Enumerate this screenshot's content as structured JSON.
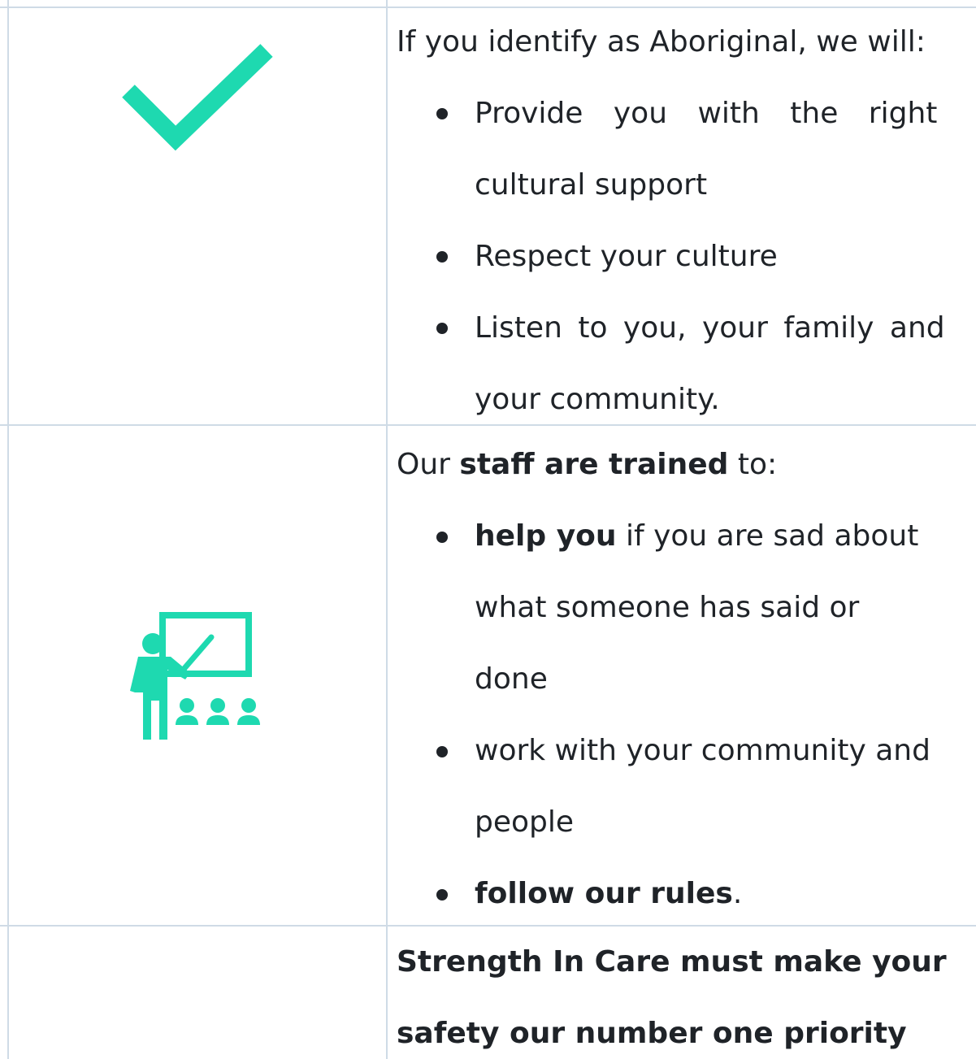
{
  "colors": {
    "accent": "#1ed9b0",
    "grid": "#cfdbe6",
    "text": "#1f2328"
  },
  "rows": [
    {
      "icon": "checkmark-icon",
      "intro": "If you identify as Aboriginal, we will:",
      "bullets": [
        {
          "line1": "Provide you with the right",
          "line2": "cultural support"
        },
        {
          "line1": "Respect your culture"
        },
        {
          "line1": "Listen to you, your family and",
          "line2": "your community."
        }
      ]
    },
    {
      "icon": "teacher-presentation-icon",
      "intro_prefix": "Our ",
      "intro_bold": "staff are trained",
      "intro_suffix": " to:",
      "bullets": [
        {
          "bold": "help you",
          "rest": " if you are sad about",
          "line2": "what someone has said or",
          "line3": "done"
        },
        {
          "line1": "work with your community and",
          "line2": "people"
        },
        {
          "bold": "follow our rules",
          "rest": "."
        }
      ]
    },
    {
      "line1": "Strength In Care must make your",
      "line2": "safety our number one priority"
    }
  ]
}
